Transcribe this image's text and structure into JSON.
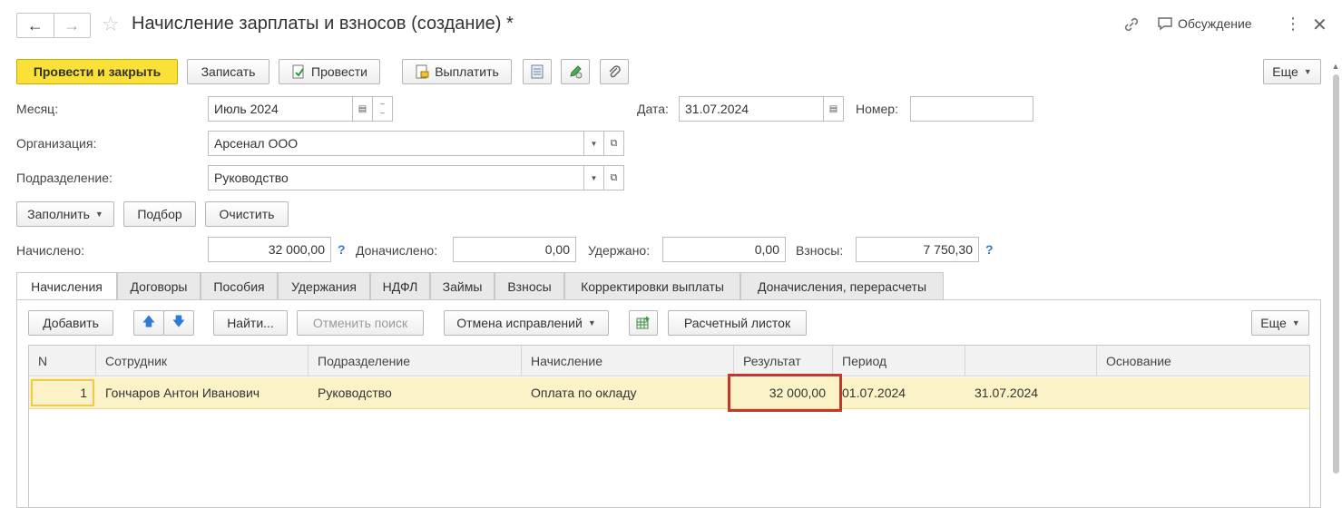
{
  "window": {
    "title": "Начисление зарплаты и взносов (создание) *",
    "discussion_label": "Обсуждение"
  },
  "toolbar": {
    "post_close": "Провести и закрыть",
    "save": "Записать",
    "post": "Провести",
    "pay": "Выплатить",
    "more": "Еще"
  },
  "form": {
    "month_label": "Месяц:",
    "month_value": "Июль 2024",
    "date_label": "Дата:",
    "date_value": "31.07.2024",
    "number_label": "Номер:",
    "number_value": "",
    "org_label": "Организация:",
    "org_value": "Арсенал ООО",
    "dept_label": "Подразделение:",
    "dept_value": "Руководство"
  },
  "actions": {
    "fill": "Заполнить",
    "select": "Подбор",
    "clear": "Очистить"
  },
  "totals": {
    "accrued_label": "Начислено:",
    "accrued_value": "32 000,00",
    "additional_label": "Доначислено:",
    "additional_value": "0,00",
    "withheld_label": "Удержано:",
    "withheld_value": "0,00",
    "contrib_label": "Взносы:",
    "contrib_value": "7 750,30",
    "help": "?"
  },
  "tabs": [
    "Начисления",
    "Договоры",
    "Пособия",
    "Удержания",
    "НДФЛ",
    "Займы",
    "Взносы",
    "Корректировки выплаты",
    "Доначисления, перерасчеты"
  ],
  "table_toolbar": {
    "add": "Добавить",
    "find": "Найти...",
    "cancel_search": "Отменить поиск",
    "cancel_fix": "Отмена исправлений",
    "payslip": "Расчетный листок",
    "more": "Еще"
  },
  "table": {
    "columns": [
      "N",
      "Сотрудник",
      "Подразделение",
      "Начисление",
      "Результат",
      "Период",
      "",
      "Основание"
    ],
    "rows": [
      [
        "1",
        "Гончаров Антон Иванович",
        "Руководство",
        "Оплата по окладу",
        "32 000,00",
        "01.07.2024",
        "31.07.2024",
        ""
      ]
    ]
  },
  "colors": {
    "primary_button": "#fbe037",
    "selected_row": "#fbf3c7",
    "highlight_border": "#c0392b",
    "help_icon": "#2f7bd3",
    "arrow_icon": "#2f7bd3"
  }
}
